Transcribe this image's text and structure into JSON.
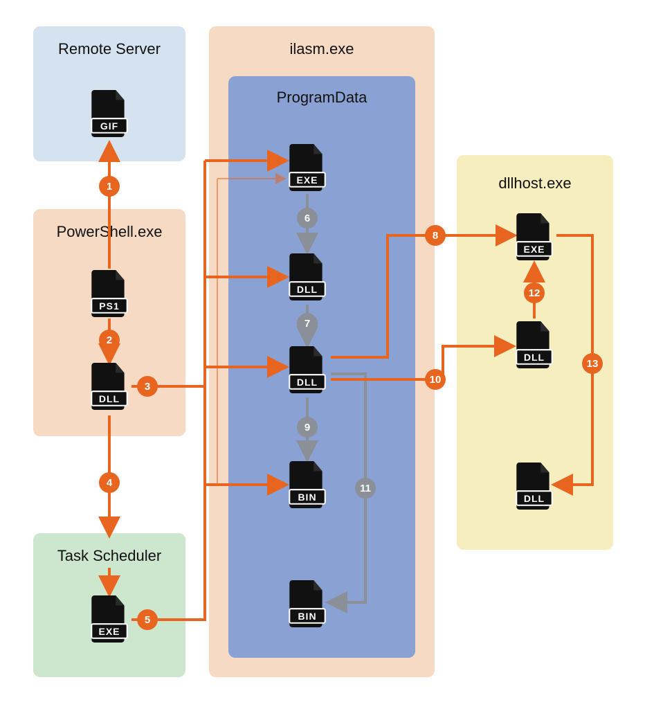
{
  "colors": {
    "remote_server_bg": "#d4e3ef",
    "powershell_bg": "#f6dac3",
    "task_sched_bg": "#cce7cd",
    "ilasm_bg": "#f6dac3",
    "programdata_bg": "#8aa1d3",
    "dllhost_bg": "#f7eec0",
    "wire_orange": "#e8651f",
    "wire_gray": "#8a8f98"
  },
  "boxes": {
    "remote_server": {
      "title": "Remote Server"
    },
    "powershell": {
      "title": "PowerShell.exe"
    },
    "task_scheduler": {
      "title": "Task Scheduler"
    },
    "ilasm": {
      "title": "ilasm.exe"
    },
    "programdata": {
      "title": "ProgramData"
    },
    "dllhost": {
      "title": "dllhost.exe"
    }
  },
  "files": {
    "remote_gif": "GIF",
    "ps1": "PS1",
    "ps_dll": "DLL",
    "ts_exe": "EXE",
    "pd_exe": "EXE",
    "pd_dll1": "DLL",
    "pd_dll2": "DLL",
    "pd_bin1": "BIN",
    "pd_bin2": "BIN",
    "dh_exe": "EXE",
    "dh_dll1": "DLL",
    "dh_dll2": "DLL"
  },
  "badges": {
    "b1": {
      "n": "1",
      "color": "orange"
    },
    "b2": {
      "n": "2",
      "color": "orange"
    },
    "b3": {
      "n": "3",
      "color": "orange"
    },
    "b4": {
      "n": "4",
      "color": "orange"
    },
    "b5": {
      "n": "5",
      "color": "orange"
    },
    "b6": {
      "n": "6",
      "color": "gray"
    },
    "b7": {
      "n": "7",
      "color": "gray"
    },
    "b8": {
      "n": "8",
      "color": "orange"
    },
    "b9": {
      "n": "9",
      "color": "gray"
    },
    "b10": {
      "n": "10",
      "color": "orange"
    },
    "b11": {
      "n": "11",
      "color": "gray"
    },
    "b12": {
      "n": "12",
      "color": "orange"
    },
    "b13": {
      "n": "13",
      "color": "orange"
    }
  },
  "flows": [
    {
      "id": 1,
      "from": "powershell/PS1",
      "to": "remote_server/GIF",
      "color": "orange"
    },
    {
      "id": 2,
      "from": "powershell/PS1",
      "to": "powershell/DLL",
      "color": "orange"
    },
    {
      "id": 3,
      "from": "powershell/DLL",
      "to": "programdata/*",
      "color": "orange",
      "fanout": [
        "pd_exe",
        "pd_dll1",
        "pd_dll2",
        "pd_bin1"
      ]
    },
    {
      "id": 4,
      "from": "powershell/DLL",
      "to": "task_scheduler",
      "color": "orange"
    },
    {
      "id": 5,
      "from": "task_scheduler/EXE",
      "to": "programdata/*",
      "color": "orange"
    },
    {
      "id": 6,
      "from": "programdata/EXE",
      "to": "programdata/DLL(1)",
      "color": "gray"
    },
    {
      "id": 7,
      "from": "programdata/DLL(1)",
      "to": "programdata/DLL(2)",
      "color": "gray"
    },
    {
      "id": 8,
      "from": "programdata/DLL(2)",
      "to": "dllhost/EXE",
      "color": "orange"
    },
    {
      "id": 9,
      "from": "programdata/DLL(2)",
      "to": "programdata/BIN(1)",
      "color": "gray"
    },
    {
      "id": 10,
      "from": "programdata/DLL(2)",
      "to": "dllhost/DLL(1)",
      "color": "orange"
    },
    {
      "id": 11,
      "from": "programdata/DLL(2)",
      "to": "programdata/BIN(2)",
      "color": "gray"
    },
    {
      "id": 12,
      "from": "dllhost/DLL(1)",
      "to": "dllhost/EXE",
      "color": "orange"
    },
    {
      "id": 13,
      "from": "dllhost/EXE",
      "to": "dllhost/DLL(2)",
      "color": "orange"
    }
  ]
}
